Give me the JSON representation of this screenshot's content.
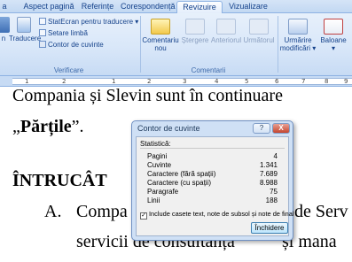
{
  "tabs": [
    {
      "label": "a",
      "active": false
    },
    {
      "label": "Aspect pagină",
      "active": false
    },
    {
      "label": "Referințe",
      "active": false
    },
    {
      "label": "Corespondență",
      "active": false
    },
    {
      "label": "Revizuire",
      "active": true
    },
    {
      "label": "Vizualizare",
      "active": false
    }
  ],
  "ribbon": {
    "proofing": {
      "translate_partial": "n",
      "translate": "Traducere",
      "screentip": "StatEcran pentru traducere",
      "language": "Setare limbă",
      "word_count": "Contor de cuvinte",
      "group_label": "Verificare"
    },
    "comments": {
      "new": "Comentariu\nnou",
      "new_line1": "Comentariu",
      "new_line2": "nou",
      "delete": "Ștergere",
      "previous": "Anteriorul",
      "next": "Următorul",
      "group_label": "Comentarii"
    },
    "tracking": {
      "track_line1": "Urmărire",
      "track_line2": "modificări",
      "balloons": "Baloane"
    }
  },
  "ruler": {
    "numbers": [
      "1",
      "2",
      "1",
      "2",
      "3",
      "4",
      "5",
      "6",
      "7",
      "8",
      "9"
    ]
  },
  "document": {
    "line1": "Compania și Slevin sunt în continuare",
    "line2_prefix": "„",
    "line2_bold": "Părțile",
    "line2_suffix": "”.",
    "line3": "ÎNTRUCÂT",
    "line4_marker": "A.",
    "line4_left": "Compa",
    "line4_right": "de Serv",
    "line5_left": "servicii de consultanță",
    "line5_right": "și mana"
  },
  "dialog": {
    "title": "Contor de cuvinte",
    "help": "?",
    "close_x": "X",
    "stats_label": "Statistică:",
    "stats": [
      {
        "label": "Pagini",
        "value": "4"
      },
      {
        "label": "Cuvinte",
        "value": "1.341"
      },
      {
        "label": "Caractere (fără spații)",
        "value": "7.689"
      },
      {
        "label": "Caractere (cu spații)",
        "value": "8.988"
      },
      {
        "label": "Paragrafe",
        "value": "75"
      },
      {
        "label": "Linii",
        "value": "188"
      }
    ],
    "checkbox_label": "Include casete text, note de subsol și note de final",
    "checkbox_checked": true,
    "checkbox_mark": "✓",
    "close_button": "Închidere"
  }
}
